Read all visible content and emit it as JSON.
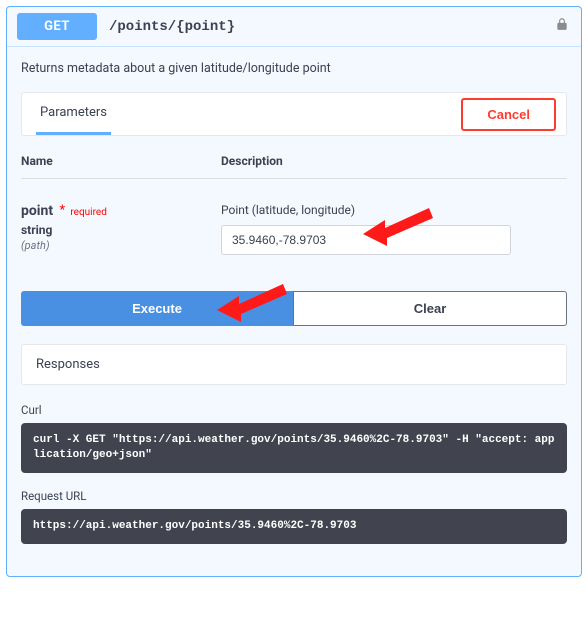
{
  "header": {
    "method": "GET",
    "path": "/points/{point}"
  },
  "summary": "Returns metadata about a given latitude/longitude point",
  "parameters": {
    "tab_label": "Parameters",
    "cancel_label": "Cancel",
    "columns": {
      "name": "Name",
      "description": "Description"
    },
    "items": [
      {
        "name": "point",
        "required_text": "required",
        "type": "string",
        "in": "(path)",
        "description": "Point (latitude, longitude)",
        "value": "35.9460,-78.9703"
      }
    ]
  },
  "buttons": {
    "execute": "Execute",
    "clear": "Clear"
  },
  "responses": {
    "title": "Responses",
    "curl_label": "Curl",
    "curl_text": "curl -X GET \"https://api.weather.gov/points/35.9460%2C-78.9703\" -H \"accept: application/geo+json\"",
    "request_url_label": "Request URL",
    "request_url_text": "https://api.weather.gov/points/35.9460%2C-78.9703"
  }
}
